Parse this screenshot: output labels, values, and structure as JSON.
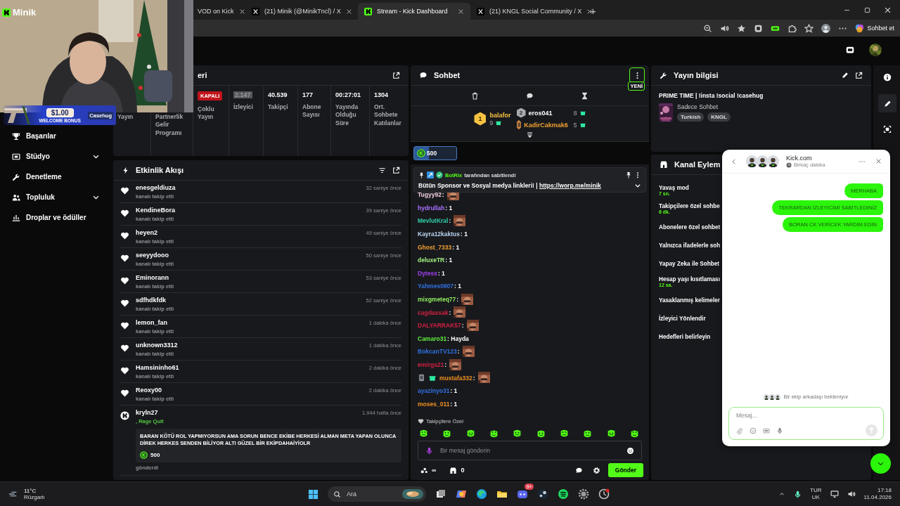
{
  "browser": {
    "tabs": [
      {
        "title": "VOD on Kick",
        "kind": "kick",
        "selected": false
      },
      {
        "title": "(21) Minik (@MinikTncl) / X",
        "kind": "x",
        "selected": false
      },
      {
        "title": "Stream - Kick Dashboard",
        "kind": "kick",
        "selected": true
      },
      {
        "title": "(21) KNGL Social Community / X",
        "kind": "x",
        "selected": false
      }
    ],
    "new_tab": "+",
    "assistant_button": "Sohbet et"
  },
  "stream_overlay": {
    "logo": "Minik",
    "bonus_amount": "$1.00",
    "bonus_text": "WELCOME BONUS",
    "bonus_brand": "Casehug"
  },
  "sidebar": {
    "items": [
      {
        "label": "Başarılar",
        "kind": "trophy",
        "expandable": false
      },
      {
        "label": "Stüdyo",
        "kind": "studio",
        "expandable": true
      },
      {
        "label": "Denetleme",
        "kind": "wrench",
        "expandable": false
      },
      {
        "label": "Topluluk",
        "kind": "people",
        "expandable": true
      },
      {
        "label": "Droplar ve ödüller",
        "kind": "drops",
        "expandable": false
      }
    ]
  },
  "stats": {
    "title": "eri",
    "items": [
      {
        "label": "Yayın",
        "highlighted": false
      },
      {
        "label": "Partnerlik Gelir Programı",
        "highlighted": false
      },
      {
        "badge": "KAPALI",
        "label": "Çoklu Yayın",
        "highlighted": false
      },
      {
        "value": "2.147",
        "label": "İzleyici",
        "highlighted": true
      },
      {
        "value": "40.539",
        "label": "Takipçi",
        "highlighted": false
      },
      {
        "value": "177",
        "label": "Abone Sayısı",
        "highlighted": false
      },
      {
        "value": "00:27:01",
        "label": "Yayında Olduğu Süre",
        "highlighted": false
      },
      {
        "value": "1304",
        "label": "Ort. Sohbete Katılanlar",
        "highlighted": false
      }
    ]
  },
  "activity": {
    "title": "Etkinlik Akışı",
    "events": [
      {
        "kind": "follow",
        "user": "enesgeldiuza",
        "action": "kanalı takip etti",
        "time": "32 saniye önce"
      },
      {
        "kind": "follow",
        "user": "KendineBora",
        "action": "kanalı takip etti",
        "time": "39 saniye önce"
      },
      {
        "kind": "follow",
        "user": "heyen2",
        "action": "kanalı takip etti",
        "time": "49 saniye önce"
      },
      {
        "kind": "follow",
        "user": "seeyydooo",
        "action": "kanalı takip etti",
        "time": "50 saniye önce"
      },
      {
        "kind": "follow",
        "user": "Eminorann",
        "action": "kanalı takip etti",
        "time": "53 saniye önce"
      },
      {
        "kind": "follow",
        "user": "sdfhdkfdk",
        "action": "kanalı takip etti",
        "time": "52 saniye önce"
      },
      {
        "kind": "follow",
        "user": "lemon_fan",
        "action": "kanalı takip etti",
        "time": "1 dakika önce"
      },
      {
        "kind": "follow",
        "user": "unknown3312",
        "action": "kanalı takip etti",
        "time": "1 dakika önce"
      },
      {
        "kind": "follow",
        "user": "Hamsininho61",
        "action": "kanalı takip etti",
        "time": "2 dakika önce"
      },
      {
        "kind": "follow",
        "user": "Reoxy00",
        "action": "kanalı takip etti",
        "time": "2 dakika önce"
      },
      {
        "kind": "tip",
        "user": "kryln27",
        "action": ", Rage Quit",
        "time": "1.944 hafta önce",
        "message": "BARAN KÖTÜ ROL YAPMIYORSUN AMA SORUN BENCE EKİBE HERKESİ ALMAN META YAPAN OLUNCA DİREK HERKES SENDEN BİLİYOR ALTI GÜZEL BİR EKİPDAHAİYİOLR",
        "amount": "500",
        "footer": "gönderdi"
      }
    ]
  },
  "chat": {
    "title": "Sohbet",
    "new_badge": "YENİ",
    "leaderboard": [
      {
        "rank": "1",
        "user": "balafor",
        "count": "9",
        "color": "#f5c242"
      },
      {
        "rank": "2",
        "user": "eros041",
        "count": "8",
        "color": "#ffffff"
      },
      {
        "rank": "3",
        "user": "KadirCakmak6",
        "count": "5",
        "color": "#f0a030"
      }
    ],
    "goal": {
      "amount": "500",
      "level": 0.35
    },
    "pinned": {
      "by": "BotRix",
      "note": "tarafından sabitlendi",
      "text": "Bütün Sponsor ve Sosyal medya linkleri! | ",
      "link": "https://worp.me/minik"
    },
    "messages": [
      {
        "user": "Tugyy92",
        "color": "#f0d0e0",
        "kind": "emote",
        "text": ":",
        "badges": false
      },
      {
        "user": "hydrullah",
        "color": "#a970ff",
        "kind": "text",
        "text": ": 1",
        "badges": false
      },
      {
        "user": "MevlutKral",
        "color": "#2ecfa8",
        "kind": "emote",
        "text": ":",
        "badges": false
      },
      {
        "user": "Kayra12kaktus",
        "color": "#b8d4f0",
        "kind": "text",
        "text": ": 1",
        "badges": false
      },
      {
        "user": "Ghost_7333",
        "color": "#f0a030",
        "kind": "text",
        "text": ": 1",
        "badges": false
      },
      {
        "user": "deluxeTR",
        "color": "#a0f080",
        "kind": "text",
        "text": ": 1",
        "badges": false
      },
      {
        "user": "Dytess",
        "color": "#a040f0",
        "kind": "text",
        "text": ": 1",
        "badges": false
      },
      {
        "user": "Yahmes0907",
        "color": "#3070e0",
        "kind": "text",
        "text": ": 1",
        "badges": false
      },
      {
        "user": "mixgmeteq77",
        "color": "#90f060",
        "kind": "emote",
        "text": ":",
        "badges": false
      },
      {
        "user": "cagdassak",
        "color": "#d02040",
        "kind": "emote",
        "text": ":",
        "badges": false
      },
      {
        "user": "DALYARRAK57",
        "color": "#d02040",
        "kind": "emote",
        "text": ":",
        "badges": false
      },
      {
        "user": "Camaro31",
        "color": "#60f040",
        "kind": "text",
        "text": ": Hayda",
        "badges": false
      },
      {
        "user": "BokcanTV123",
        "color": "#3070e0",
        "kind": "emote",
        "text": ":",
        "badges": false
      },
      {
        "user": "emirgs21",
        "color": "#d02040",
        "kind": "emote",
        "text": ":",
        "badges": false
      },
      {
        "user": "mustafa332",
        "color": "#f09020",
        "kind": "emote",
        "text": ":",
        "badges": true
      },
      {
        "user": "ayazinyo31",
        "color": "#3070e0",
        "kind": "text",
        "text": ": 1",
        "badges": false
      },
      {
        "user": "moses_011",
        "color": "#f09020",
        "kind": "text",
        "text": ": 1",
        "badges": false
      }
    ],
    "emote_section": "Takipçilere Özel",
    "placeholder": "Bir mesaj gönderin",
    "points": "∞",
    "store_count": "0",
    "send_button": "Gönder"
  },
  "stream_info": {
    "title": "Yayın bilgisi",
    "stream_title": "PRIME TIME | !insta !social !casehug",
    "category": "Sadece Sohbet",
    "tags": [
      "Turkish",
      "KNGL"
    ]
  },
  "channel_actions": {
    "title": "Kanal Eylem",
    "items": [
      {
        "label": "Yavaş mod",
        "value": "7 sn."
      },
      {
        "label": "Takipçilere özel sohbe",
        "value": "6 dk."
      },
      {
        "label": "Abonelere özel sohbet"
      },
      {
        "label": "Yalnızca ifadelerle soh"
      },
      {
        "label": "Yapay Zeka ile Sohbet"
      },
      {
        "label": "Hesap yaşı kısıtlaması",
        "value": "12 sa."
      },
      {
        "label": "Yasaklanmış kelimeler"
      },
      {
        "label": "İzleyici Yönlendir"
      },
      {
        "label": "Hedefleri belirleyin"
      }
    ]
  },
  "support_chat": {
    "name": "Kick.com",
    "status": "Birkaç dakika",
    "messages": [
      "MERHABA",
      "TEKRARDAN İZLEYİCİMİ SABİTLEDİNİZ",
      "BORAN CK VERİCEK YARDIM EDİN"
    ],
    "waiting": "Bir ekip arkadaşı bekleniyor",
    "placeholder": "Mesaj..."
  },
  "taskbar": {
    "temperature": "11°C",
    "weather": "Rüzgarlı",
    "search": "Ara",
    "app_badge": "9+",
    "language": "TUR",
    "layout": "UK",
    "time": "17:18",
    "date": "11.04.2026"
  }
}
